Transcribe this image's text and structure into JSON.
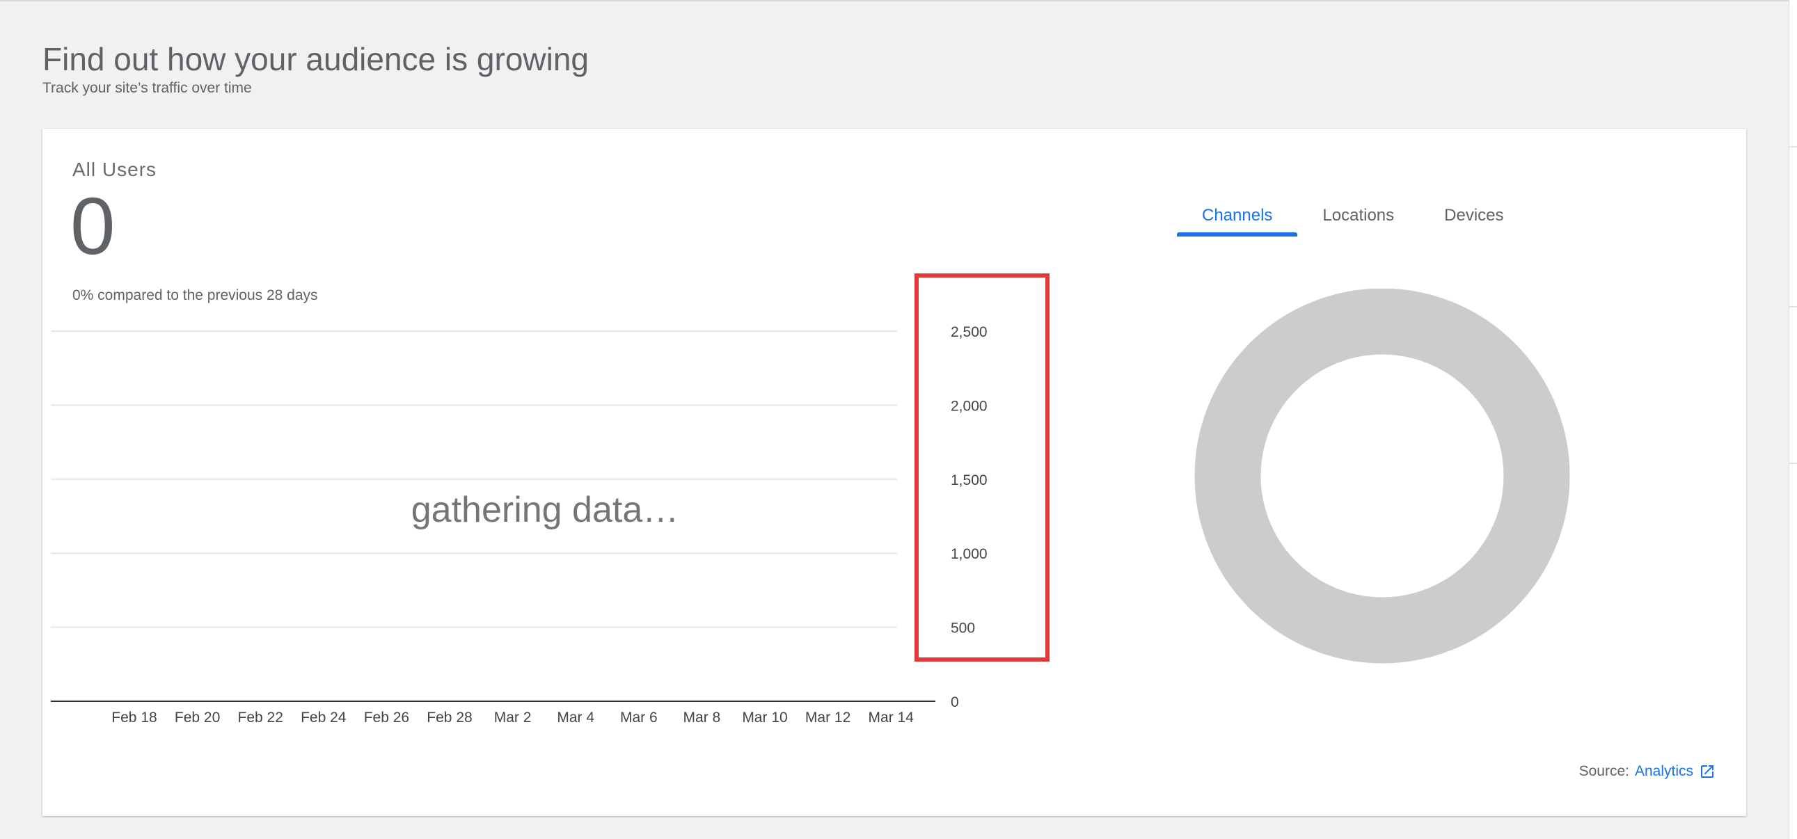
{
  "page": {
    "title": "Find out how your audience is growing",
    "subtitle": "Track your site’s traffic over time"
  },
  "card": {
    "metric_label": "All Users",
    "metric_value": "0",
    "compare_text": "0% compared to the previous 28 days",
    "overlay_text": "gathering data…",
    "tabs": [
      {
        "label": "Channels",
        "active": true
      },
      {
        "label": "Locations",
        "active": false
      },
      {
        "label": "Devices",
        "active": false
      }
    ],
    "source_label": "Source:",
    "source_link": "Analytics",
    "source_icon": "external-link-icon"
  },
  "colors": {
    "accent": "#1a73e8",
    "highlight": "#e53935",
    "donut": "#cccccc",
    "text": "#5f6368"
  },
  "chart_data": [
    {
      "type": "line",
      "x": [
        "Feb 18",
        "Feb 20",
        "Feb 22",
        "Feb 24",
        "Feb 26",
        "Feb 28",
        "Mar 2",
        "Mar 4",
        "Mar 6",
        "Mar 8",
        "Mar 10",
        "Mar 12",
        "Mar 14"
      ],
      "y_ticks": [
        "0",
        "500",
        "1,000",
        "1,500",
        "2,000",
        "2,500"
      ],
      "ylim": [
        0,
        2500
      ],
      "series": [],
      "grid": true,
      "y_axis_side": "right"
    },
    {
      "type": "pie",
      "variant": "donut",
      "slices": [],
      "empty": true
    }
  ]
}
